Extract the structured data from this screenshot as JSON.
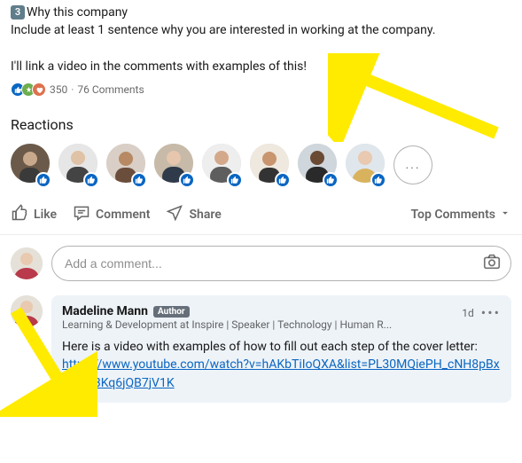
{
  "post": {
    "badge_number": "3",
    "line1_after": "Why this company",
    "line2": "Include at least 1 sentence why you are interested in working at the company.",
    "line3": "I'll link a video in the comments with examples of this!",
    "reactions_count": "350",
    "comments_count": "76 Comments"
  },
  "reactions": {
    "title": "Reactions",
    "more_label": "..."
  },
  "actions": {
    "like": "Like",
    "comment": "Comment",
    "share": "Share",
    "sort": "Top Comments"
  },
  "comment_input": {
    "placeholder": "Add a comment..."
  },
  "comment": {
    "name": "Madeline Mann",
    "author_badge": "Author",
    "headline": "Learning & Development at Inspire | Speaker | Technology | Human R...",
    "time": "1d",
    "body": "Here is a video with examples of how to fill out each step of the cover letter:",
    "link": "https://www.youtube.com/watch?v=hAKbTiIoQXA&list=PL30MQiePH_cNH8pBxvmZZ3Kq6jQB7jV1K"
  },
  "icons": {
    "like": "like-icon",
    "comment": "comment-icon",
    "share": "share-icon",
    "camera": "camera-icon",
    "chevron": "chevron-down-icon"
  },
  "colors": {
    "link": "#0a66c2",
    "comment_bg": "#eef3f8"
  }
}
